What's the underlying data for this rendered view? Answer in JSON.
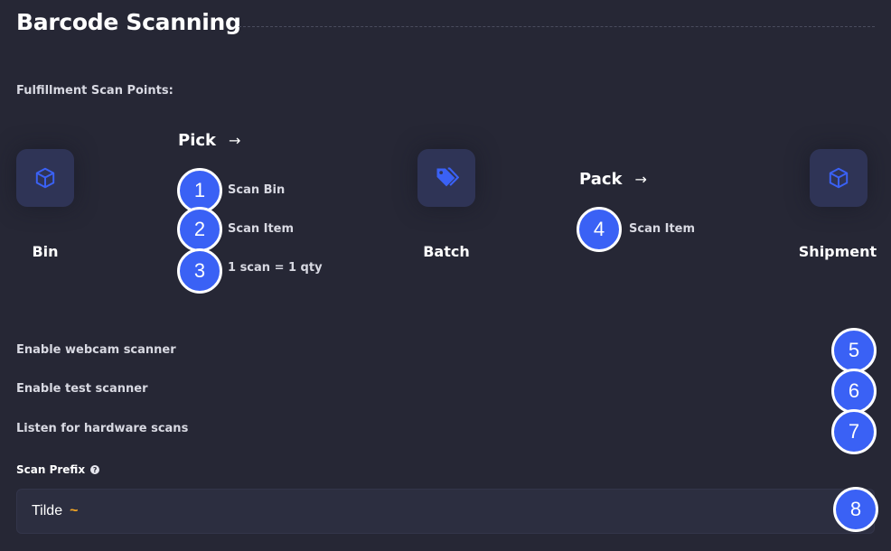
{
  "page": {
    "title": "Barcode Scanning",
    "scan_points_label": "Fulfillment Scan Points:"
  },
  "flow": {
    "nodes": [
      {
        "label": "Bin",
        "icon": "cube-icon"
      },
      {
        "label": "Batch",
        "icon": "tags-icon"
      },
      {
        "label": "Shipment",
        "icon": "cube-icon"
      }
    ],
    "steps": [
      {
        "title": "Pick",
        "items": [
          {
            "number": "1",
            "label": "Scan Bin"
          },
          {
            "number": "2",
            "label": "Scan Item"
          },
          {
            "number": "3",
            "label": "1 scan = 1 qty"
          }
        ]
      },
      {
        "title": "Pack",
        "items": [
          {
            "number": "4",
            "label": "Scan Item"
          }
        ]
      }
    ]
  },
  "settings": [
    {
      "number": "5",
      "label": "Enable webcam scanner"
    },
    {
      "number": "6",
      "label": "Enable test scanner"
    },
    {
      "number": "7",
      "label": "Listen for hardware scans"
    }
  ],
  "scan_prefix": {
    "label": "Scan Prefix",
    "help_icon": "question-circle-icon",
    "value": "Tilde",
    "symbol": "~",
    "number": "8"
  },
  "colors": {
    "background": "#262735",
    "tile": "#2f3456",
    "icon_blue": "#3a61f5",
    "badge_blue": "#3a61f5",
    "tilde_accent": "#f5a623"
  }
}
